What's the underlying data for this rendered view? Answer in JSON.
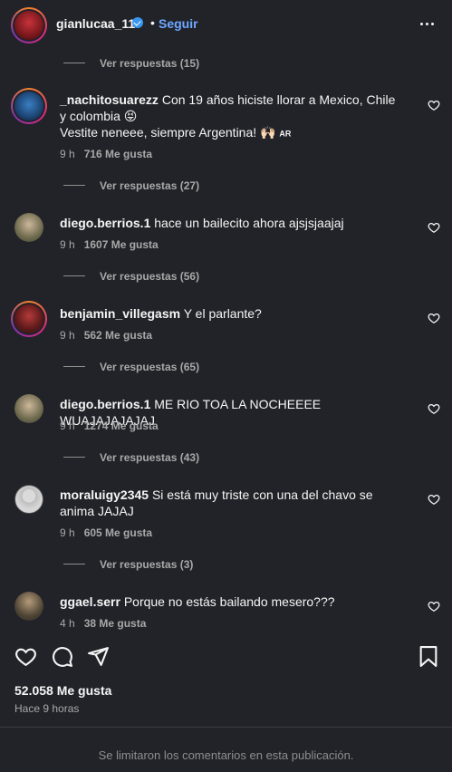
{
  "header": {
    "username": "gianlucaa_11",
    "dot": "•",
    "follow_label": "Seguir"
  },
  "comments": [
    {
      "username": "_nachitosuarezz",
      "text": "Con 19 años hiciste llorar a Mexico, Chile y colombia 😝",
      "text2": "Vestite neneee, siempre Argentina! 🙌🏻",
      "flag": "AR",
      "time": "9 h",
      "likes": "716 Me gusta",
      "replies": "Ver respuestas (27)"
    },
    {
      "username": "diego.berrios.1",
      "text": "hace un bailecito ahora ajsjsjaajaj",
      "time": "9 h",
      "likes": "1607 Me gusta",
      "replies": "Ver respuestas (56)"
    },
    {
      "username": "benjamin_villegasm",
      "text": "Y el parlante?",
      "time": "9 h",
      "likes": "562 Me gusta",
      "replies": "Ver respuestas (65)"
    },
    {
      "username": "diego.berrios.1",
      "text": "ME RIO TOA LA NOCHEEEE WUAJAJAJAJAJ",
      "time": "9 h",
      "likes": "1274 Me gusta",
      "replies": "Ver respuestas (43)"
    },
    {
      "username": "moraluigy2345",
      "text": "Si está muy triste con una del chavo se anima JAJAJ",
      "time": "9 h",
      "likes": "605 Me gusta",
      "replies": "Ver respuestas (3)"
    },
    {
      "username": "ggael.serr",
      "text": "Porque no estás bailando mesero???",
      "time": "4 h",
      "likes": "38 Me gusta"
    }
  ],
  "top_replies": "Ver respuestas (15)",
  "post": {
    "likes": "52.058 Me gusta",
    "time": "Hace 9 horas",
    "limited_notice": "Se limitaron los comentarios en esta publicación."
  },
  "colors": {
    "background": "#222329",
    "link": "#6ea8ff",
    "muted": "#a8a8a8"
  }
}
